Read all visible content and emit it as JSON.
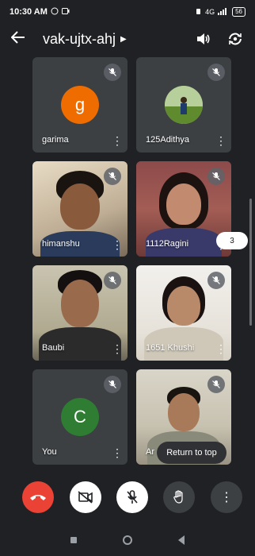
{
  "status_bar": {
    "time": "10:30 AM",
    "network": "4G",
    "battery": "56"
  },
  "meeting": {
    "code": "vak-ujtx-ahj"
  },
  "participants": [
    {
      "name": "garima",
      "type": "avatar",
      "initial": "g",
      "avatar_color": "#ef6c00"
    },
    {
      "name": "125Adithya",
      "type": "photo"
    },
    {
      "name": "himanshu",
      "type": "video"
    },
    {
      "name": "1112Ragini",
      "type": "video"
    },
    {
      "name": "Baubi",
      "type": "video"
    },
    {
      "name": "1651 Khushi",
      "type": "video"
    },
    {
      "name": "You",
      "type": "avatar",
      "initial": "C",
      "avatar_color": "#2e7d32"
    },
    {
      "name": "Ar",
      "type": "video"
    }
  ],
  "participant_count": "3",
  "return_to_top_label": "Return to top",
  "colors": {
    "background": "#202124",
    "end_call": "#ea4335"
  }
}
